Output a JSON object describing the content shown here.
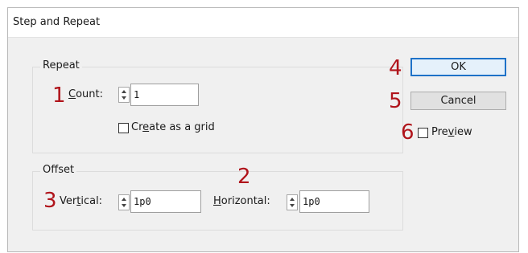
{
  "dialog": {
    "title": "Step and Repeat"
  },
  "repeat": {
    "group_label": "Repeat",
    "count_label_pre": "",
    "count_label_u": "C",
    "count_label_post": "ount:",
    "count_value": "1",
    "grid_label_pre": "Cr",
    "grid_label_u": "e",
    "grid_label_post": "ate as a grid"
  },
  "offset": {
    "group_label": "Offset",
    "vertical_label_pre": "Ver",
    "vertical_label_u": "t",
    "vertical_label_post": "ical:",
    "vertical_value": "1p0",
    "horizontal_label_pre": "",
    "horizontal_label_u": "H",
    "horizontal_label_post": "orizontal:",
    "horizontal_value": "1p0"
  },
  "buttons": {
    "ok": "OK",
    "cancel": "Cancel"
  },
  "preview": {
    "label_pre": "Pre",
    "label_u": "v",
    "label_post": "iew"
  },
  "annotations": {
    "n1": "1",
    "n2": "2",
    "n3": "3",
    "n4": "4",
    "n5": "5",
    "n6": "6"
  },
  "colors": {
    "annotation": "#b0141b",
    "default_button_border": "#1e72c8"
  }
}
